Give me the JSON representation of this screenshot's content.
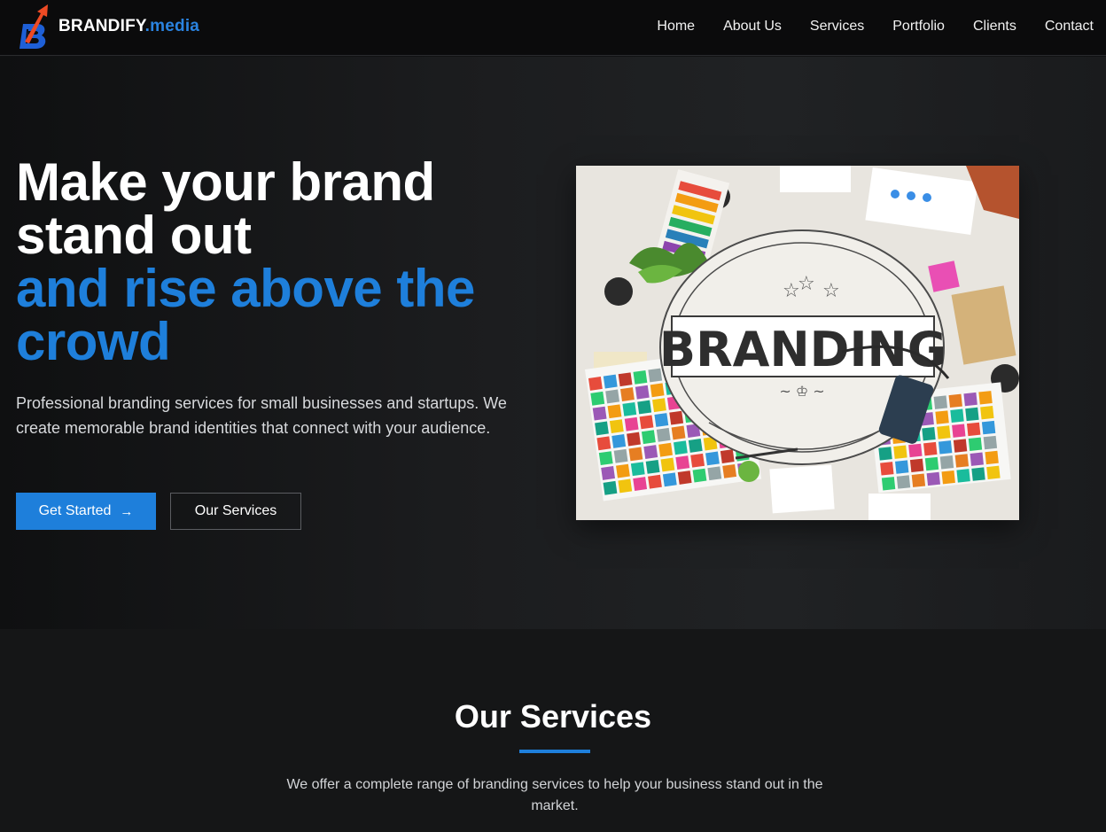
{
  "brand": {
    "name": "BRANDIFY",
    "suffix": ".media",
    "accent_color": "#2a83e0"
  },
  "nav": {
    "items": [
      "Home",
      "About Us",
      "Services",
      "Portfolio",
      "Clients",
      "Contact"
    ]
  },
  "hero": {
    "title_line1": "Make your brand",
    "title_line2": "stand out",
    "title_line3": "and rise above the",
    "title_line4": "crowd",
    "description": "Professional branding services for small businesses and startups. We create memorable brand identities that connect with your audience.",
    "primary_button": "Get Started",
    "secondary_button": "Our Services",
    "image_text": "BRANDING",
    "primary_color": "#1e7fdb"
  },
  "services": {
    "title": "Our Services",
    "description": "We offer a complete range of branding services to help your business stand out in the market."
  },
  "icons": {
    "logo": "brandify-logo-icon",
    "arrow": "arrow-right-icon"
  }
}
